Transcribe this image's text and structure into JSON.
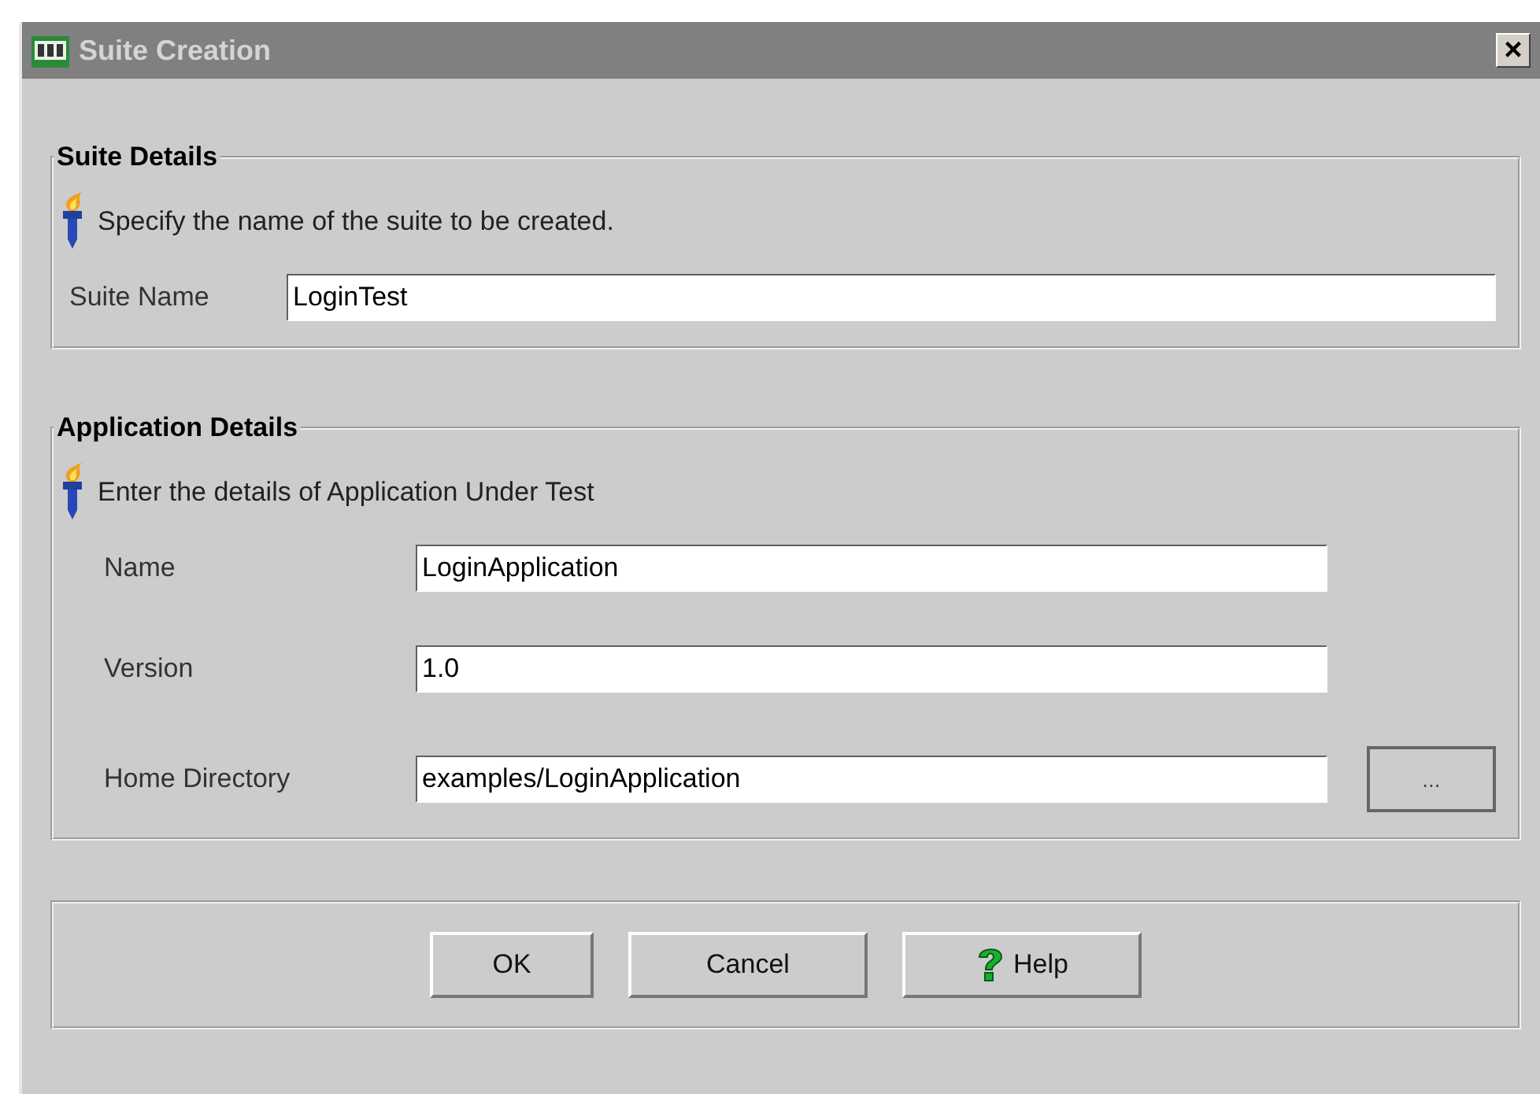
{
  "window": {
    "title": "Suite Creation",
    "close": "×"
  },
  "sections": [
    {
      "kind": "compact",
      "title": "Suite Details",
      "hint": "Specify the name of the suite to be created.",
      "fields": [
        {
          "label": "Suite Name",
          "value": "LoginTest"
        }
      ]
    },
    {
      "kind": "form",
      "title": "Application Details",
      "hint": "Enter the details of Application Under Test",
      "fields": [
        {
          "label": "Name",
          "value": "LoginApplication"
        },
        {
          "label": "Version",
          "value": "1.0"
        },
        {
          "label": "Home Directory",
          "value": "examples/LoginApplication",
          "browse_label": "..."
        }
      ]
    }
  ],
  "buttons": [
    {
      "label": "OK",
      "kind": "plain"
    },
    {
      "label": "Cancel",
      "kind": "plain"
    },
    {
      "label": "Help",
      "kind": "help"
    }
  ]
}
